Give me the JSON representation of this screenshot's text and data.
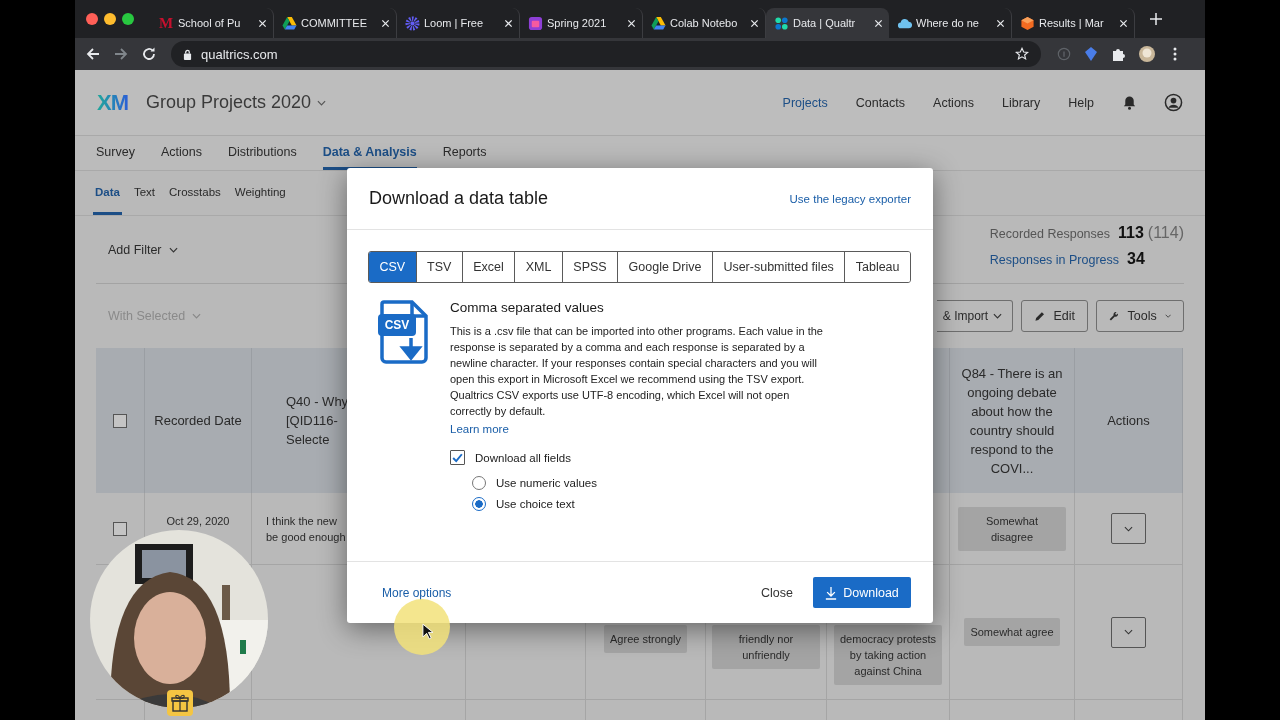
{
  "browser": {
    "tabs": [
      {
        "kind": "letter",
        "mark": "M",
        "title": "School of Pu",
        "selected": false
      },
      {
        "kind": "drive",
        "title": "COMMITTEE",
        "selected": false
      },
      {
        "kind": "loom",
        "title": "Loom | Free",
        "selected": false
      },
      {
        "kind": "calendar",
        "title": "Spring 2021",
        "selected": false
      },
      {
        "kind": "drive",
        "title": "Colab Notebo",
        "selected": false
      },
      {
        "kind": "dots",
        "title": "Data | Qualtr",
        "selected": true
      },
      {
        "kind": "cloud",
        "title": "Where do ne",
        "selected": false
      },
      {
        "kind": "hex",
        "title": "Results | Mar",
        "selected": false
      }
    ],
    "url": "qualtrics.com"
  },
  "header": {
    "logo": "XM",
    "project": "Group Projects 2020",
    "nav": [
      {
        "label": "Projects",
        "selected": true
      },
      {
        "label": "Contacts",
        "selected": false
      },
      {
        "label": "Actions",
        "selected": false
      },
      {
        "label": "Library",
        "selected": false
      },
      {
        "label": "Help",
        "selected": false
      }
    ]
  },
  "sections": [
    {
      "label": "Survey",
      "selected": false
    },
    {
      "label": "Actions",
      "selected": false
    },
    {
      "label": "Distributions",
      "selected": false
    },
    {
      "label": "Data & Analysis",
      "selected": true
    },
    {
      "label": "Reports",
      "selected": false
    }
  ],
  "subtabs": [
    {
      "label": "Data",
      "selected": true
    },
    {
      "label": "Text",
      "selected": false
    },
    {
      "label": "Crosstabs",
      "selected": false
    },
    {
      "label": "Weighting",
      "selected": false
    }
  ],
  "filter": "Add Filter",
  "with_selected": "With Selected",
  "stats": {
    "recorded_label": "Recorded Responses",
    "recorded": "113",
    "recorded_total": "(114)",
    "progress_label": "Responses in Progress",
    "progress": "34"
  },
  "toolbar": {
    "import": "& Import",
    "edit": "Edit",
    "tools": "Tools"
  },
  "table": {
    "select_all_checked": false,
    "headers": {
      "recorded_date": "Recorded Date",
      "q40": "Q40 - Why\n[QID116-\nSelecte",
      "q84": "Q84 - There is an ongoing debate about how the country should respond to the COVI...",
      "actions": "Actions"
    },
    "rows": [
      {
        "checked": false,
        "recorded_date": "Oct 29, 2020",
        "q40": "I think the new\nbe good enough",
        "q84": "Somewhat disagree"
      },
      {
        "column_5": "Agree strongly",
        "column_6": "friendly nor unfriendly",
        "column_7": "democracy protests by taking action against China",
        "q84": "Somewhat agree"
      }
    ]
  },
  "dialog": {
    "title": "Download a data table",
    "legacy_link": "Use the legacy exporter",
    "formats": [
      {
        "label": "CSV",
        "selected": true
      },
      {
        "label": "TSV",
        "selected": false
      },
      {
        "label": "Excel",
        "selected": false
      },
      {
        "label": "XML",
        "selected": false
      },
      {
        "label": "SPSS",
        "selected": false
      },
      {
        "label": "Google Drive",
        "selected": false
      },
      {
        "label": "User-submitted files",
        "selected": false
      },
      {
        "label": "Tableau",
        "selected": false
      }
    ],
    "file_badge": "CSV",
    "format_title": "Comma separated values",
    "description": "This is a .csv file that can be imported into other programs. Each value in the response is separated by a comma and each response is separated by a newline character. If your responses contain special characters and you will open this export in Microsoft Excel we recommend using the TSV export. Qualtrics CSV exports use UTF-8 encoding, which Excel will not open correctly by default.",
    "learn_more": "Learn more",
    "download_all": {
      "label": "Download all fields",
      "checked": true
    },
    "value_options": [
      {
        "label": "Use numeric values",
        "selected": false
      },
      {
        "label": "Use choice text",
        "selected": true
      }
    ],
    "more_options": "More options",
    "close": "Close",
    "download": "Download"
  }
}
